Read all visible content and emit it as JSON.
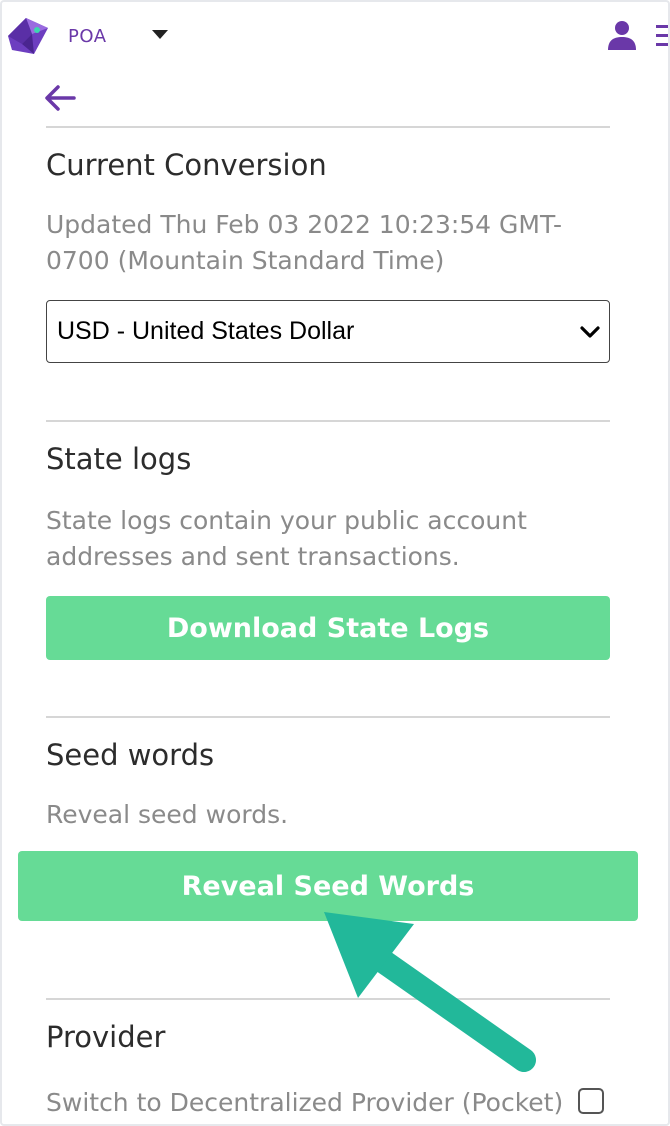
{
  "header": {
    "network_label": "POA",
    "colors": {
      "accent": "#6a38a8",
      "logo_main": "#6d3ec0"
    }
  },
  "icons": {
    "logo": "wallet-logo-icon",
    "network_caret": "caret-down-icon",
    "account": "account-icon",
    "menu": "hamburger-menu-icon",
    "back": "back-arrow-icon"
  },
  "conversion": {
    "title": "Current Conversion",
    "updated_text": "Updated Thu Feb 03 2022 10:23:54 GMT-0700 (Mountain Standard Time)",
    "selected_currency": "USD - United States Dollar"
  },
  "state_logs": {
    "title": "State logs",
    "description": "State logs contain your public account addresses and sent transactions.",
    "button_label": "Download State Logs"
  },
  "seed_words": {
    "title": "Seed words",
    "description": "Reveal seed words.",
    "button_label": "Reveal Seed Words"
  },
  "provider": {
    "title": "Provider",
    "toggle_label": "Switch to Decentralized Provider (Pocket)",
    "checked": false
  },
  "colors": {
    "button_green": "#66db96",
    "annotation_arrow": "#22b89a",
    "divider": "#d6d6d6"
  }
}
